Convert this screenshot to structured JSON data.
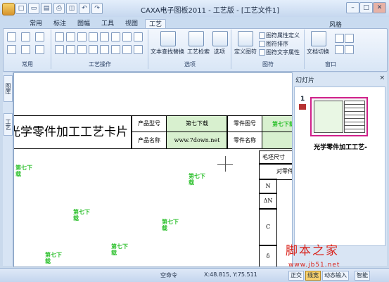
{
  "window": {
    "title": "CAXA电子图板2011 - 工艺版 - [工艺文件1]",
    "controls": {
      "minimize": "–",
      "maximize": "□",
      "close": "✕"
    }
  },
  "quick_access": [
    "□",
    "▭",
    "▤",
    "⎙",
    "◫",
    "↶",
    "↷"
  ],
  "ribbon": {
    "tabs": [
      "常用",
      "标注",
      "图幅",
      "工具",
      "视图",
      "工艺"
    ],
    "active_tab": "工艺",
    "style_label": "风格",
    "groups": [
      {
        "label": "常用"
      },
      {
        "label": "工艺操作"
      },
      {
        "label": "选项",
        "buttons": [
          "文本查找替换",
          "工艺检索",
          "选项"
        ]
      },
      {
        "label": "图符",
        "buttons": [
          "定义图符"
        ],
        "small_buttons": [
          "图符属性定义",
          "图符排序",
          "图符文字属性"
        ]
      },
      {
        "label": "窗口",
        "buttons": [
          "文档切换"
        ]
      }
    ]
  },
  "sidebar": {
    "tabs": [
      "图库",
      "工艺"
    ]
  },
  "document": {
    "title": "光学零件加工工艺卡片",
    "rows": [
      {
        "label": "产品型号",
        "value": "第七下载",
        "label2": "零件图号",
        "value2": "第七下载"
      },
      {
        "label": "产品名称",
        "value": "www.7down.net",
        "label2": "零件名称",
        "value2": ""
      }
    ],
    "right_column": [
      "毛坯尺寸",
      "对零件",
      "N",
      "ΔN",
      "C",
      "δ"
    ],
    "watermark": [
      "第七下",
      "载"
    ]
  },
  "slides_panel": {
    "title": "幻灯片",
    "close": "×",
    "slide_number": "1",
    "caption": "光学零件加工工艺-"
  },
  "statusbar": {
    "command": "空命令",
    "coords": "X:48.815, Y:75.511",
    "buttons": [
      "正交",
      "线宽",
      "动态输入",
      "智能"
    ],
    "active_button": "线宽"
  },
  "site_watermark": {
    "name": "脚本之家",
    "url": "www.jb51.net"
  }
}
